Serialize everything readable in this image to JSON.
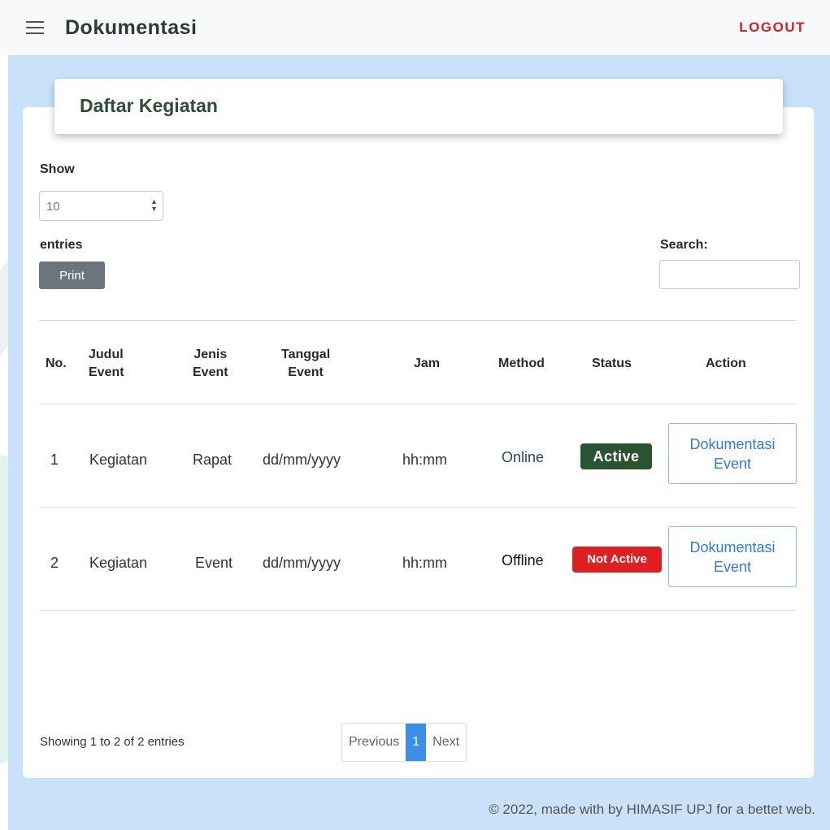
{
  "header": {
    "title": "Dokumentasi",
    "logout_label": "LOGOUT"
  },
  "card": {
    "title": "Daftar Kegiatan"
  },
  "controls": {
    "show_label": "Show",
    "length_value": "10",
    "entries_label": "entries",
    "print_label": "Print",
    "search_label": "Search:",
    "search_value": ""
  },
  "table": {
    "headers": {
      "no": "No.",
      "judul_line1": "Judul",
      "judul_line2": "Event",
      "jenis_line1": "Jenis",
      "jenis_line2": "Event",
      "tanggal_line1": "Tanggal",
      "tanggal_line2": "Event",
      "jam": "Jam",
      "method": "Method",
      "status": "Status",
      "action": "Action"
    },
    "rows": [
      {
        "no": "1",
        "judul": "Kegiatan",
        "jenis": "Rapat",
        "tanggal": "dd/mm/yyyy",
        "jam": "hh:mm",
        "method": "Online",
        "status": "Active",
        "action_line1": "Dokumentasi",
        "action_line2": "Event"
      },
      {
        "no": "2",
        "judul": "Kegiatan",
        "jenis": "Event",
        "tanggal": "dd/mm/yyyy",
        "jam": "hh:mm",
        "method": "Offline",
        "status": "Not Active",
        "action_line1": "Dokumentasi",
        "action_line2": "Event"
      }
    ]
  },
  "pagination": {
    "info": "Showing 1 to 2 of 2 entries",
    "previous": "Previous",
    "current": "1",
    "next": "Next"
  },
  "footer": {
    "text": "© 2022, made with by HIMASIF UPJ for a bettet web."
  },
  "colors": {
    "accent_blue": "#3b8fe8",
    "content_bg": "#c9e1f9",
    "active_badge": "#2a5331",
    "inactive_badge": "#e02020",
    "logout": "#d32020"
  }
}
